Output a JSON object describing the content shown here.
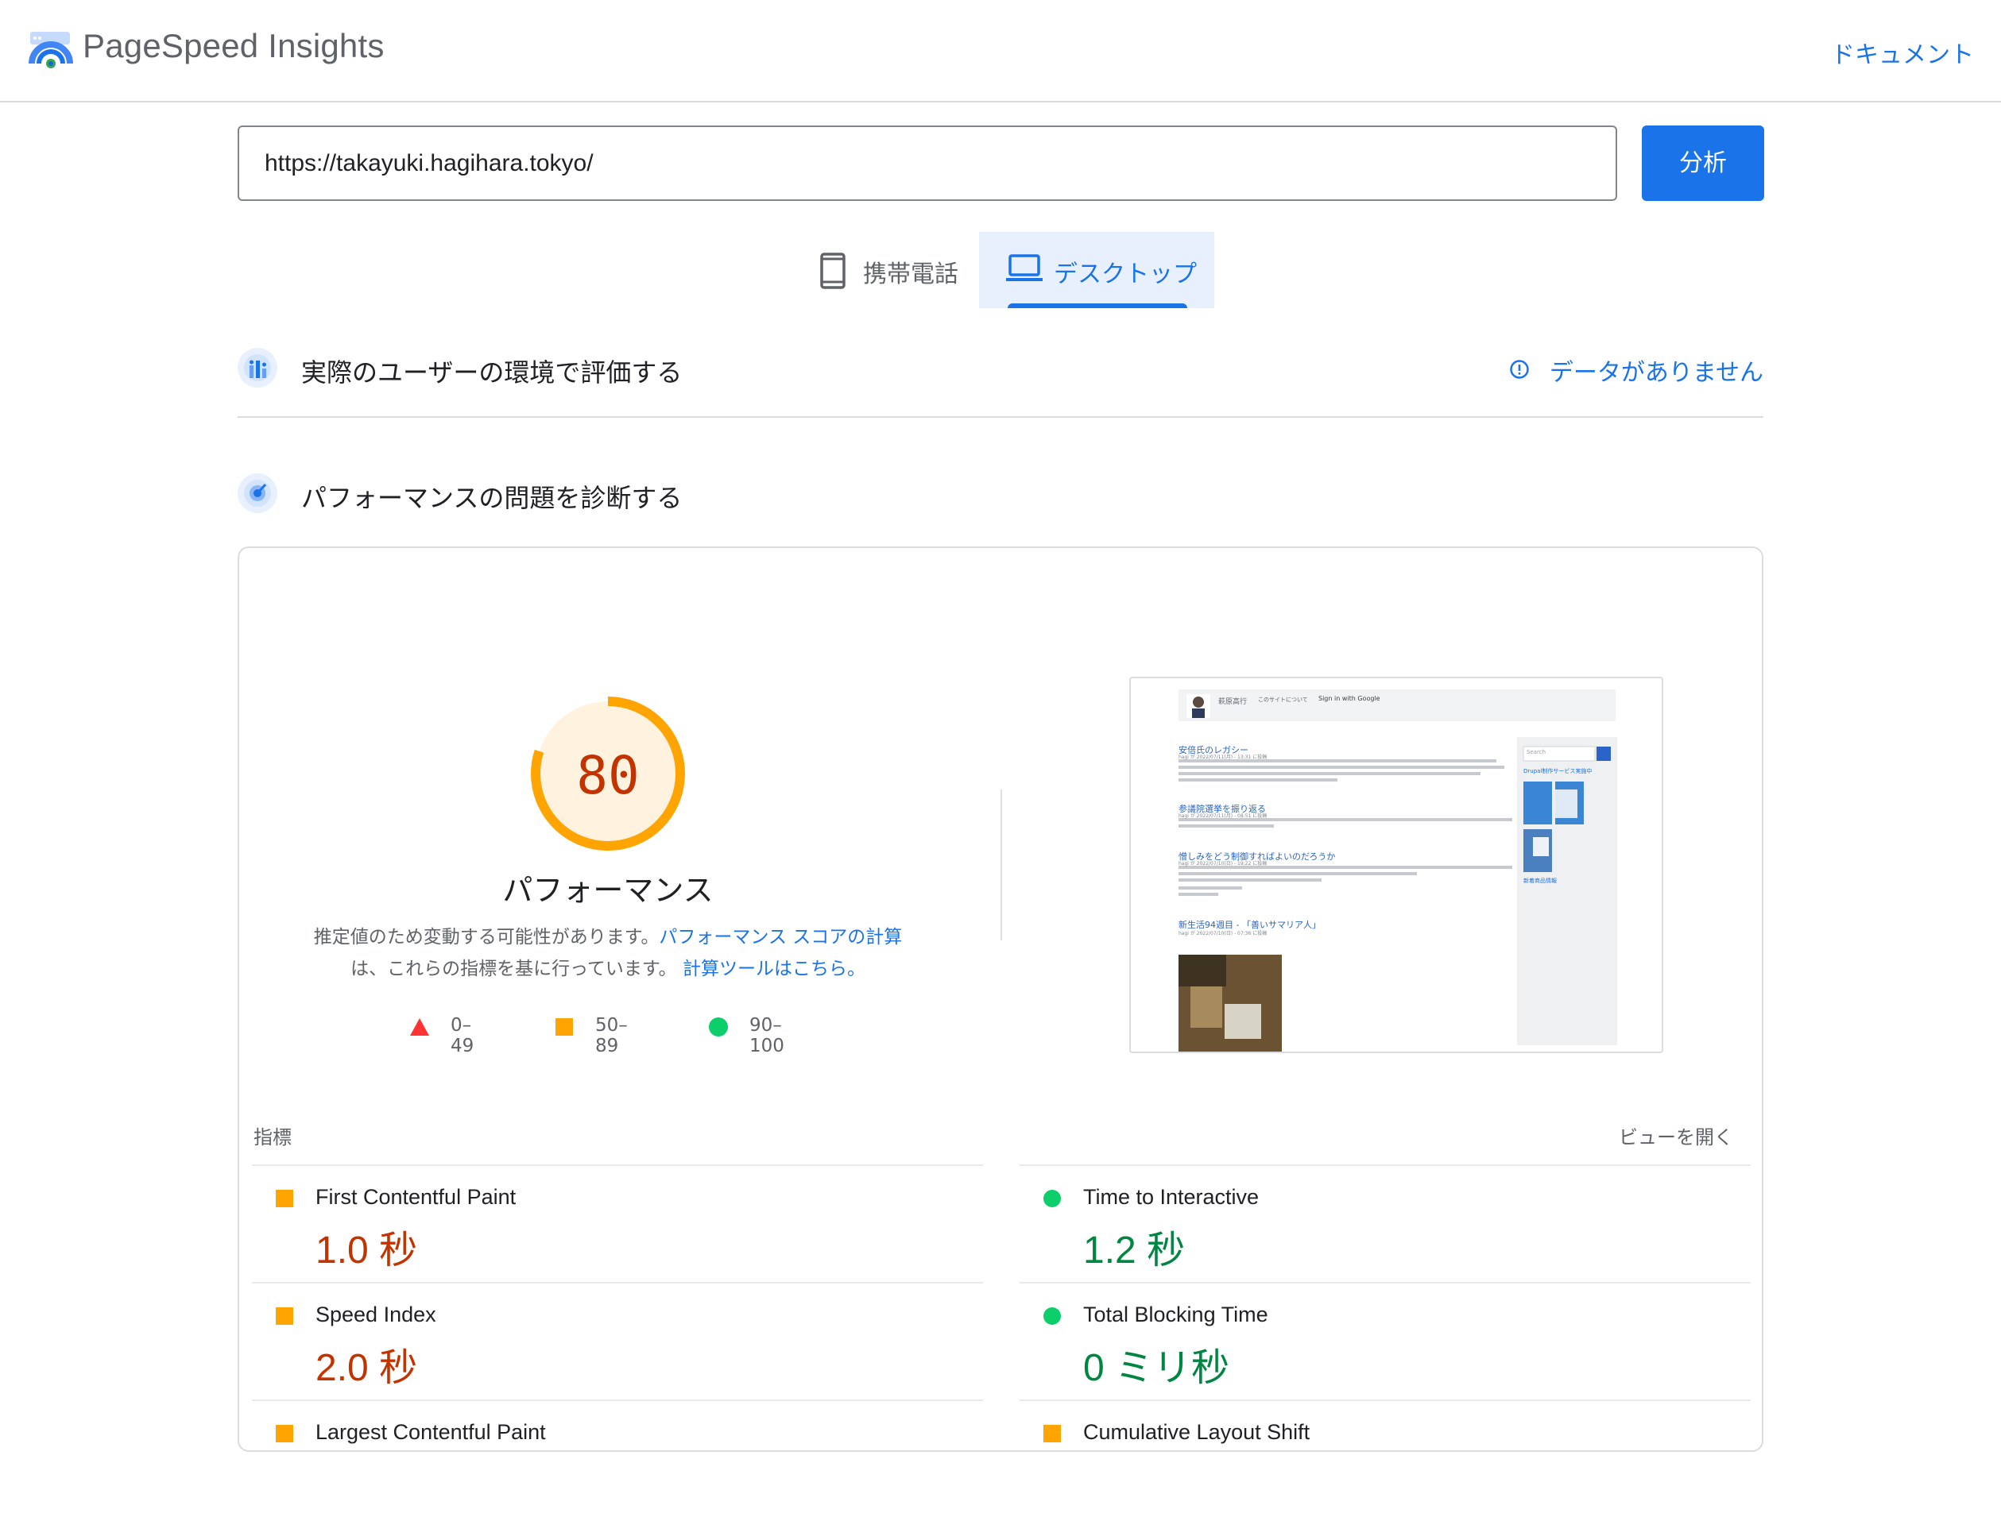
{
  "header": {
    "brand": "PageSpeed Insights",
    "docs_link": "ドキュメント"
  },
  "search": {
    "url_value": "https://takayuki.hagihara.tokyo/",
    "analyze_label": "分析"
  },
  "device_tabs": {
    "mobile": "携帯電話",
    "desktop": "デスクトップ",
    "selected": "desktop"
  },
  "field_data": {
    "title": "実際のユーザーの環境で評価する",
    "status": "データがありません"
  },
  "lab_data": {
    "title": "パフォーマンスの問題を診断する"
  },
  "performance": {
    "score": "80",
    "score_value": 80,
    "label": "パフォーマンス",
    "desc_text_1": "推定値のため変動する可能性があります。",
    "desc_link_1": "パフォーマンス スコアの計算",
    "desc_text_2": "は、これらの指標を基に行っています。",
    "desc_link_2": "計算ツールはこちら。",
    "legend": {
      "fail": "0–49",
      "average": "50–89",
      "pass": "90–100"
    }
  },
  "metrics": {
    "section_title": "指標",
    "expand_label": "ビューを開く",
    "fcp": {
      "name": "First Contentful Paint",
      "value": "1.0 秒",
      "status": "average"
    },
    "tti": {
      "name": "Time to Interactive",
      "value": "1.2 秒",
      "status": "pass"
    },
    "si": {
      "name": "Speed Index",
      "value": "2.0 秒",
      "status": "average"
    },
    "tbt": {
      "name": "Total Blocking Time",
      "value": "0 ミリ秒",
      "status": "pass"
    },
    "lcp": {
      "name": "Largest Contentful Paint"
    },
    "cls": {
      "name": "Cumulative Layout Shift"
    }
  },
  "screenshot": {
    "site_name": "萩原高行",
    "nav_about": "このサイトについて",
    "signin": "Sign in with Google",
    "search_placeholder": "Search",
    "sidebar_heading": "Drupal制作サービス実施中",
    "sidebar_footer": "新着商品情報",
    "posts": [
      {
        "title": "安倍氏のレガシー",
        "meta": "hagi が 2022/07/11(月) - 13:31 に投稿"
      },
      {
        "title": "参議院選挙を振り返る",
        "meta": "hagi が 2022/07/11(月) - 08:51 に投稿"
      },
      {
        "title": "憎しみをどう制御すればよいのだろうか",
        "meta": "hagi が 2022/07/10(日) - 19:22 に投稿"
      },
      {
        "title": "新生活94週目 - 「善いサマリア人」",
        "meta": "hagi が 2022/07/10(日) - 07:36 に投稿"
      }
    ]
  },
  "colors": {
    "accent": "#1a73e8",
    "average": "#ffa400",
    "fail": "#ff3333",
    "pass": "#0cce6b",
    "average_text": "#c33300",
    "pass_text": "#018642"
  }
}
